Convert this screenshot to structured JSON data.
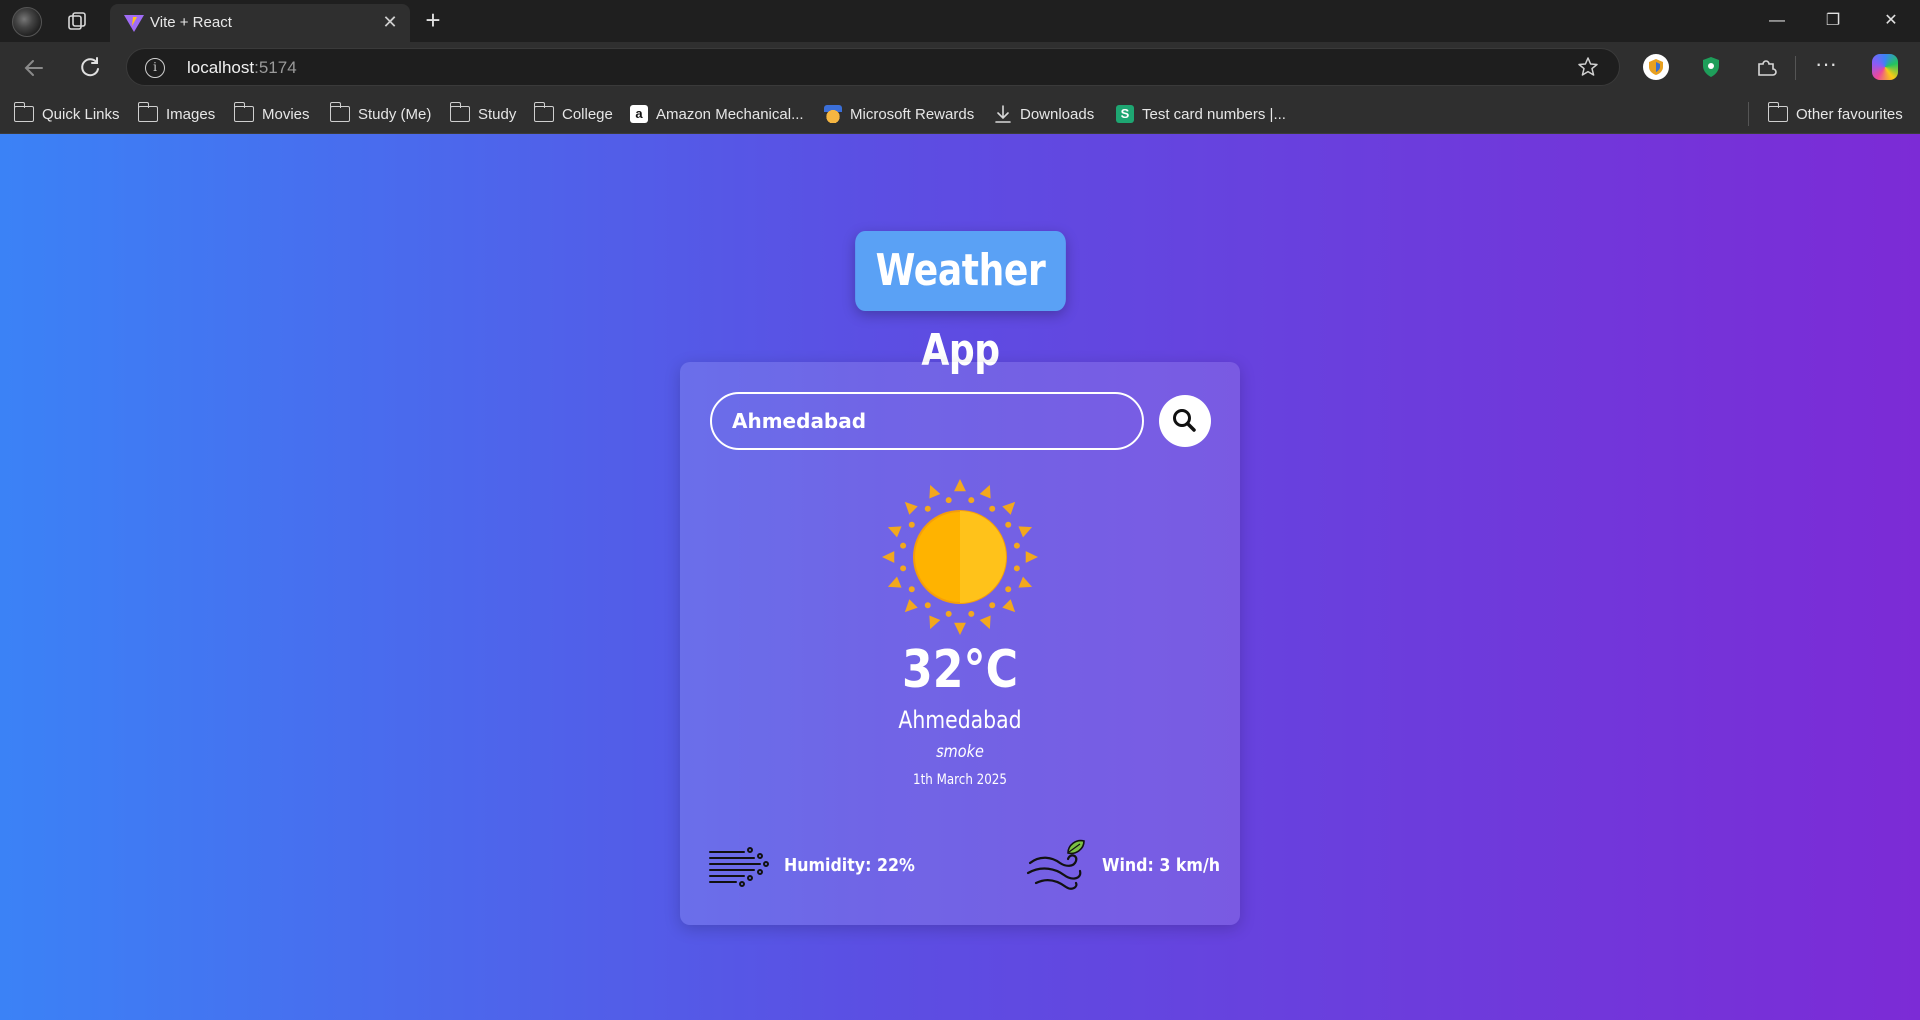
{
  "browser": {
    "tab_title": "Vite + React",
    "url_host": "localhost",
    "url_port": ":5174",
    "bookmarks": [
      {
        "label": "Quick Links",
        "icon": "folder-icon"
      },
      {
        "label": "Images",
        "icon": "folder-icon"
      },
      {
        "label": "Movies",
        "icon": "folder-icon"
      },
      {
        "label": "Study (Me)",
        "icon": "folder-icon"
      },
      {
        "label": "Study",
        "icon": "folder-icon"
      },
      {
        "label": "College",
        "icon": "folder-icon"
      },
      {
        "label": "Amazon Mechanical...",
        "icon": "amazon-icon"
      },
      {
        "label": "Microsoft Rewards",
        "icon": "medal-icon"
      },
      {
        "label": "Downloads",
        "icon": "download-icon"
      },
      {
        "label": "Test card numbers |...",
        "icon": "stripe-icon"
      }
    ],
    "other_favourites": "Other favourites"
  },
  "app": {
    "title": "Weather App",
    "search": {
      "value": "Ahmedabad",
      "placeholder": "Search"
    },
    "weather": {
      "icon": "sun-icon",
      "temperature": "32°C",
      "city": "Ahmedabad",
      "description": "smoke",
      "date": "1th March 2025"
    },
    "humidity_label": "Humidity: 22%",
    "wind_label": "Wind: 3 km/h"
  },
  "colors": {
    "gradient_start": "#3b82f6",
    "gradient_end": "#7c2bd6",
    "title_bg": "#5aa1f5",
    "sun": "#ffb300"
  }
}
